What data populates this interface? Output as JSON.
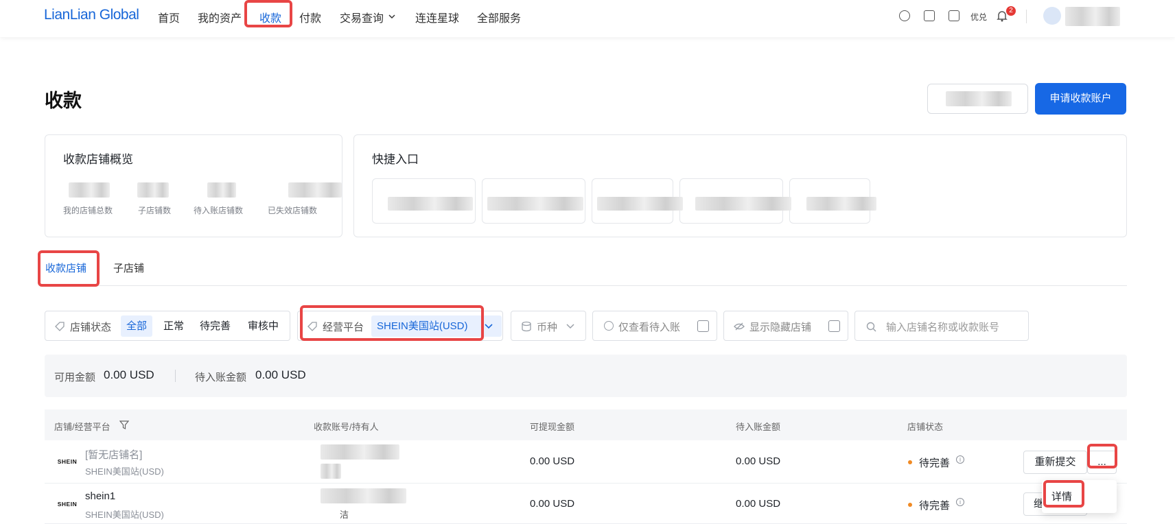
{
  "nav": {
    "logo": "LianLian Global",
    "items": [
      "首页",
      "我的资产",
      "收款",
      "付款",
      "交易查询",
      "连连星球",
      "全部服务"
    ],
    "redeem": "优兑",
    "notification_count": "2"
  },
  "header": {
    "title": "收款",
    "apply_button": "申请收款账户"
  },
  "overview": {
    "title": "收款店铺概览",
    "stats": [
      "我的店铺总数",
      "子店铺数",
      "待入账店铺数",
      "已失效店铺数"
    ]
  },
  "quick": {
    "title": "快捷入口"
  },
  "tabs": [
    "收款店铺",
    "子店铺"
  ],
  "filters": {
    "status_label": "店铺状态",
    "status_options": [
      "全部",
      "正常",
      "待完善",
      "审核中"
    ],
    "platform_label": "经营平台",
    "platform_value": "SHEIN美国站(USD)",
    "currency_label": "币种",
    "pending_only": "仅查看待入账",
    "show_hidden": "显示隐藏店铺",
    "search_placeholder": "输入店铺名称或收款账号"
  },
  "summary": {
    "available_label": "可用金额",
    "available_value": "0.00 USD",
    "pending_label": "待入账金额",
    "pending_value": "0.00 USD"
  },
  "table": {
    "headers": [
      "店铺/经营平台",
      "收款账号/持有人",
      "可提现金额",
      "待入账金额",
      "店铺状态"
    ],
    "rows": [
      {
        "logo": "SHEIN",
        "name": "[暂无店铺名]",
        "platform": "SHEIN美国站(USD)",
        "withdrawable": "0.00 USD",
        "pending": "0.00 USD",
        "status": "待完善",
        "action": "重新提交",
        "more": "..."
      },
      {
        "logo": "SHEIN",
        "name": "shein1",
        "platform": "SHEIN美国站(USD)",
        "holder_tail": "洁",
        "withdrawable": "0.00 USD",
        "pending": "0.00 USD",
        "status": "待完善",
        "action": "继"
      }
    ],
    "popover_item": "详情"
  }
}
